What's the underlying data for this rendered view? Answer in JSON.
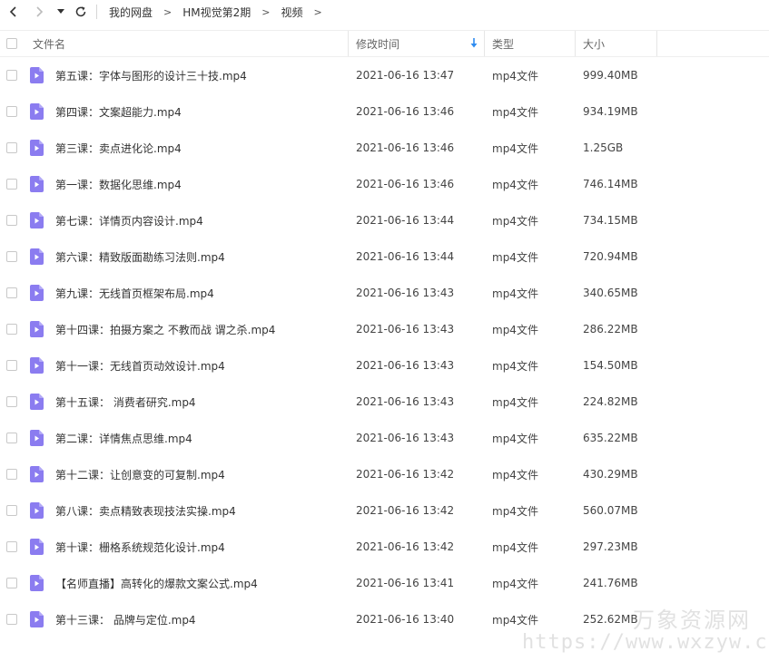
{
  "toolbar": {
    "back_icon": "chevron-left-icon",
    "forward_icon": "chevron-right-icon",
    "history_icon": "caret-down-icon",
    "refresh_icon": "refresh-icon"
  },
  "breadcrumb": {
    "items": [
      "我的网盘",
      "HM视觉第2期",
      "视频"
    ],
    "separator": ">"
  },
  "table": {
    "headers": {
      "name": "文件名",
      "modified": "修改时间",
      "type": "类型",
      "size": "大小"
    },
    "sort": {
      "column": "modified",
      "direction": "descending",
      "icon": "arrow-down-icon",
      "color": "#2f8cf0"
    },
    "file_icon_color": "#8b7cf0",
    "rows": [
      {
        "name": "第五课：字体与图形的设计三十技.mp4",
        "modified": "2021-06-16 13:47",
        "type": "mp4文件",
        "size": "999.40MB"
      },
      {
        "name": "第四课：文案超能力.mp4",
        "modified": "2021-06-16 13:46",
        "type": "mp4文件",
        "size": "934.19MB"
      },
      {
        "name": "第三课：卖点进化论.mp4",
        "modified": "2021-06-16 13:46",
        "type": "mp4文件",
        "size": "1.25GB"
      },
      {
        "name": "第一课：数据化思维.mp4",
        "modified": "2021-06-16 13:46",
        "type": "mp4文件",
        "size": "746.14MB"
      },
      {
        "name": "第七课：详情页内容设计.mp4",
        "modified": "2021-06-16 13:44",
        "type": "mp4文件",
        "size": "734.15MB"
      },
      {
        "name": "第六课：精致版面勘练习法则.mp4",
        "modified": "2021-06-16 13:44",
        "type": "mp4文件",
        "size": "720.94MB"
      },
      {
        "name": "第九课：无线首页框架布局.mp4",
        "modified": "2021-06-16 13:43",
        "type": "mp4文件",
        "size": "340.65MB"
      },
      {
        "name": "第十四课：拍摄方案之 不教而战 谓之杀.mp4",
        "modified": "2021-06-16 13:43",
        "type": "mp4文件",
        "size": "286.22MB"
      },
      {
        "name": "第十一课：无线首页动效设计.mp4",
        "modified": "2021-06-16 13:43",
        "type": "mp4文件",
        "size": "154.50MB"
      },
      {
        "name": "第十五课： 消费者研究.mp4",
        "modified": "2021-06-16 13:43",
        "type": "mp4文件",
        "size": "224.82MB"
      },
      {
        "name": "第二课：详情焦点思维.mp4",
        "modified": "2021-06-16 13:43",
        "type": "mp4文件",
        "size": "635.22MB"
      },
      {
        "name": "第十二课：让创意变的可复制.mp4",
        "modified": "2021-06-16 13:42",
        "type": "mp4文件",
        "size": "430.29MB"
      },
      {
        "name": "第八课：卖点精致表现技法实操.mp4",
        "modified": "2021-06-16 13:42",
        "type": "mp4文件",
        "size": "560.07MB"
      },
      {
        "name": "第十课：栅格系统规范化设计.mp4",
        "modified": "2021-06-16 13:42",
        "type": "mp4文件",
        "size": "297.23MB"
      },
      {
        "name": "【名师直播】高转化的爆款文案公式.mp4",
        "modified": "2021-06-16 13:41",
        "type": "mp4文件",
        "size": "241.76MB"
      },
      {
        "name": "第十三课： 品牌与定位.mp4",
        "modified": "2021-06-16 13:40",
        "type": "mp4文件",
        "size": "252.62MB"
      }
    ]
  },
  "watermark": {
    "text_cn": "万象资源网",
    "text_url": "https://www.wxzyw.cn"
  }
}
